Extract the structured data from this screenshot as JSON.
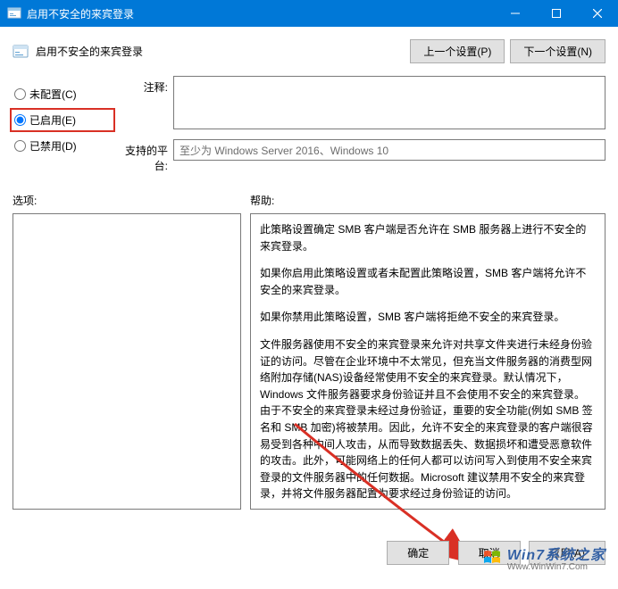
{
  "window": {
    "title": "启用不安全的来宾登录"
  },
  "header": {
    "policy_name": "启用不安全的来宾登录",
    "prev_setting": "上一个设置(P)",
    "next_setting": "下一个设置(N)"
  },
  "radios": {
    "not_configured": "未配置(C)",
    "enabled": "已启用(E)",
    "disabled": "已禁用(D)",
    "selected": "enabled"
  },
  "labels": {
    "comment": "注释:",
    "supported": "支持的平台:",
    "options": "选项:",
    "help": "帮助:"
  },
  "fields": {
    "comment_value": "",
    "supported_value": "至少为 Windows Server 2016、Windows 10"
  },
  "help": {
    "p1": "此策略设置确定 SMB 客户端是否允许在 SMB 服务器上进行不安全的来宾登录。",
    "p2": "如果你启用此策略设置或者未配置此策略设置，SMB 客户端将允许不安全的来宾登录。",
    "p3": "如果你禁用此策略设置，SMB 客户端将拒绝不安全的来宾登录。",
    "p4": "文件服务器使用不安全的来宾登录来允许对共享文件夹进行未经身份验证的访问。尽管在企业环境中不太常见，但充当文件服务器的消费型网络附加存储(NAS)设备经常使用不安全的来宾登录。默认情况下，Windows 文件服务器要求身份验证并且不会使用不安全的来宾登录。由于不安全的来宾登录未经过身份验证，重要的安全功能(例如 SMB 签名和 SMB 加密)将被禁用。因此，允许不安全的来宾登录的客户端很容易受到各种中间人攻击，从而导致数据丢失、数据损坏和遭受恶意软件的攻击。此外，可能网络上的任何人都可以访问写入到使用不安全来宾登录的文件服务器中的任何数据。Microsoft 建议禁用不安全的来宾登录，并将文件服务器配置为要求经过身份验证的访问。"
  },
  "buttons": {
    "ok": "确定",
    "cancel": "取消",
    "apply": "应用(A)"
  },
  "watermark": {
    "main": "Win7系统之家",
    "sub": "Www.WinWin7.Com"
  }
}
